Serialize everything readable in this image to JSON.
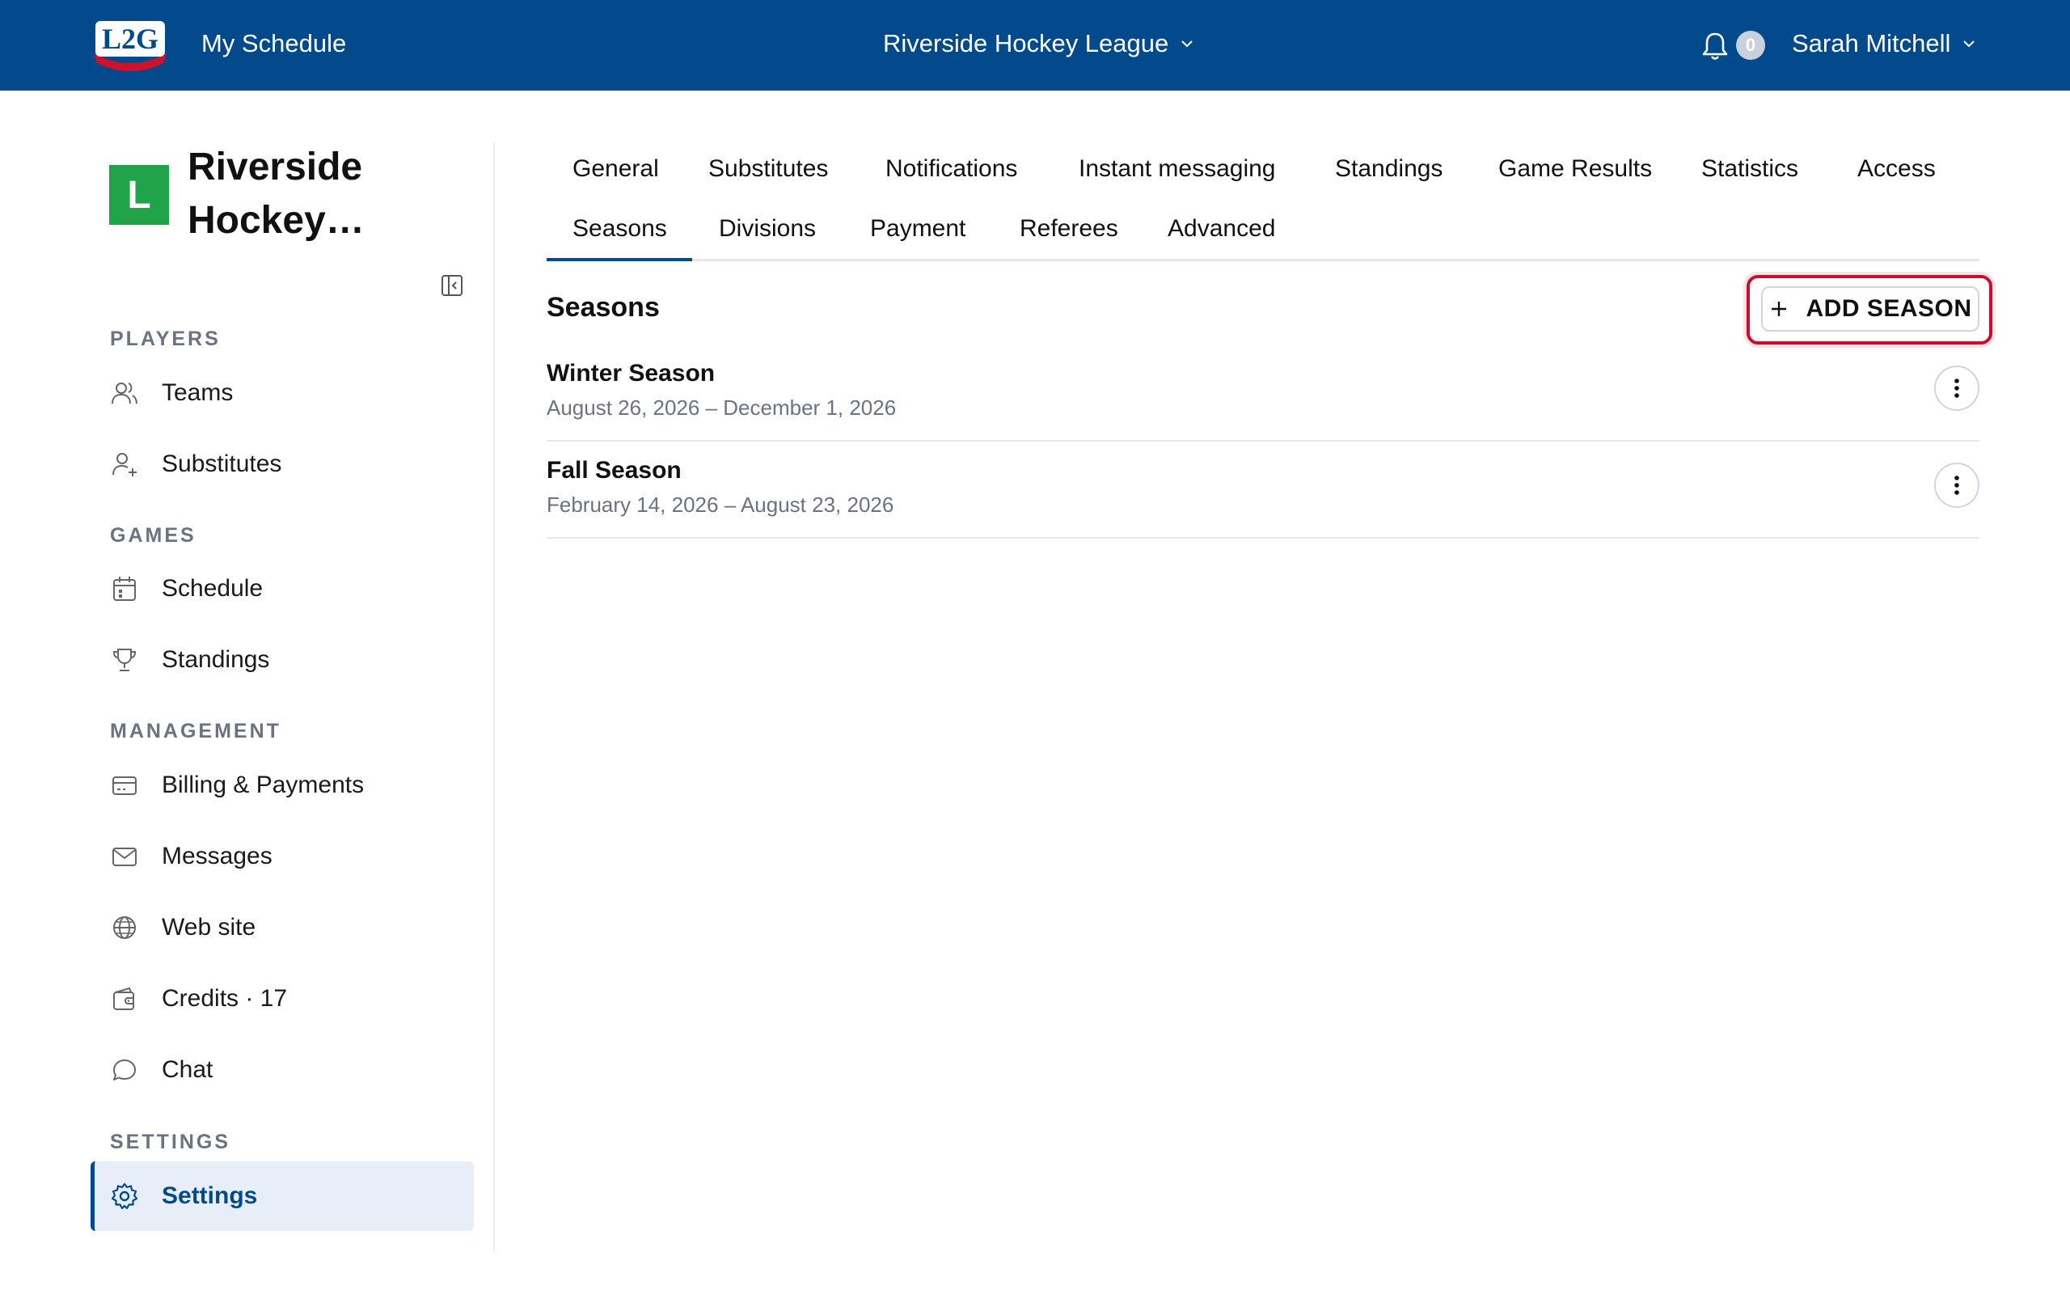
{
  "header": {
    "logo_text": "L2G",
    "my_schedule": "My Schedule",
    "league": "Riverside Hockey League",
    "notification_count": "0",
    "user_name": "Sarah Mitchell"
  },
  "sidebar": {
    "org_initial": "L",
    "org_name": "Riverside Hockey…",
    "sections": {
      "players": "PLAYERS",
      "games": "GAMES",
      "management": "MANAGEMENT",
      "settings": "SETTINGS"
    },
    "items": {
      "teams": "Teams",
      "substitutes": "Substitutes",
      "schedule": "Schedule",
      "standings": "Standings",
      "billing": "Billing & Payments",
      "messages": "Messages",
      "website": "Web site",
      "credits": "Credits · 17",
      "chat": "Chat",
      "settings": "Settings"
    }
  },
  "tabs": {
    "general": "General",
    "substitutes": "Substitutes",
    "notifications": "Notifications",
    "instant_messaging": "Instant messaging",
    "standings": "Standings",
    "game_results": "Game Results",
    "statistics": "Statistics",
    "access": "Access",
    "seasons": "Seasons",
    "divisions": "Divisions",
    "payment": "Payment",
    "referees": "Referees",
    "advanced": "Advanced",
    "active": "Seasons"
  },
  "content": {
    "title": "Seasons",
    "add_button": "ADD SEASON",
    "seasons": [
      {
        "name": "Winter Season",
        "dates": "August 26, 2026 – December 1, 2026"
      },
      {
        "name": "Fall Season",
        "dates": "February 14, 2026 – August 23, 2026"
      }
    ]
  },
  "colors": {
    "brand_blue": "#034a8d",
    "org_green": "#21a349",
    "highlight_red": "#c8102e"
  }
}
